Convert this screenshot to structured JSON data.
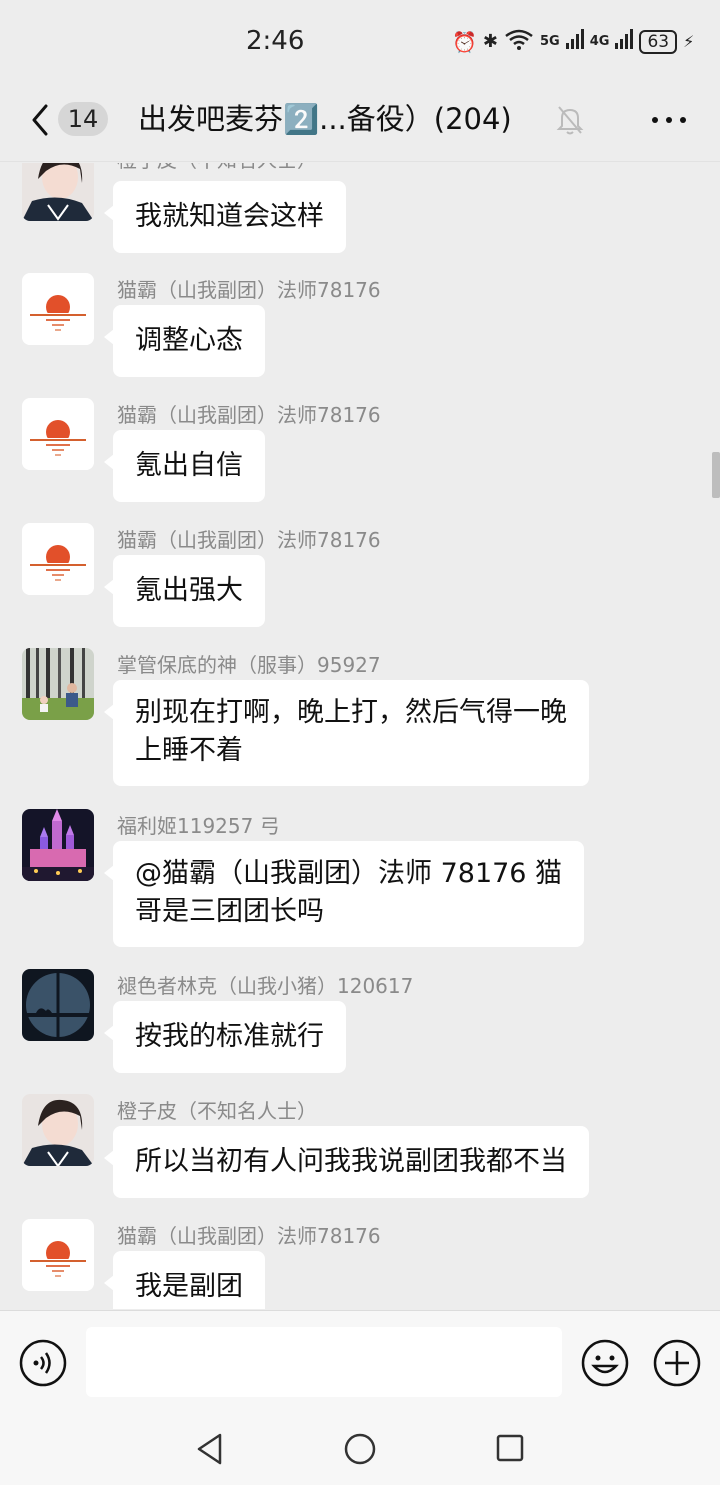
{
  "status_bar": {
    "time": "2:46",
    "signal_5g": "5G",
    "signal_4g": "4G",
    "battery": "63"
  },
  "header": {
    "unread_count": "14",
    "title": "出发吧麦芬2️⃣...备役）(204)"
  },
  "messages": [
    {
      "sender": "橙子皮（不知名人士）",
      "text": "我就知道会这样",
      "avatar": "girl-portrait"
    },
    {
      "sender": "猫霸（山我副团）法师78176",
      "text": "调整心态",
      "avatar": "sunset-reflection"
    },
    {
      "sender": "猫霸（山我副团）法师78176",
      "text": "氪出自信",
      "avatar": "sunset-reflection"
    },
    {
      "sender": "猫霸（山我副团）法师78176",
      "text": "氪出强大",
      "avatar": "sunset-reflection"
    },
    {
      "sender": "掌管保底的神（服事）95927",
      "text_line1": "别现在打啊，晚上打，然后气得一晚",
      "text_line2": "上睡不着",
      "avatar": "forest-people"
    },
    {
      "sender": "福利姬119257 弓",
      "text_line1": "@猫霸（山我副团）法师 78176  猫",
      "text_line2": "哥是三团团长吗",
      "avatar": "castle-night"
    },
    {
      "sender": "褪色者林克（山我小猪）120617",
      "text": "按我的标准就行",
      "avatar": "window-night"
    },
    {
      "sender": "橙子皮（不知名人士）",
      "text": "所以当初有人问我我说副团我都不当",
      "avatar": "girl-portrait"
    },
    {
      "sender": "猫霸（山我副团）法师78176",
      "text": "我是副团",
      "avatar": "sunset-reflection"
    }
  ],
  "input": {
    "placeholder": ""
  },
  "icons": {
    "back": "chevron-left-icon",
    "mute": "bell-off-icon",
    "more": "more-dots-icon",
    "voice": "voice-icon",
    "emoji": "emoji-icon",
    "plus": "plus-icon"
  }
}
